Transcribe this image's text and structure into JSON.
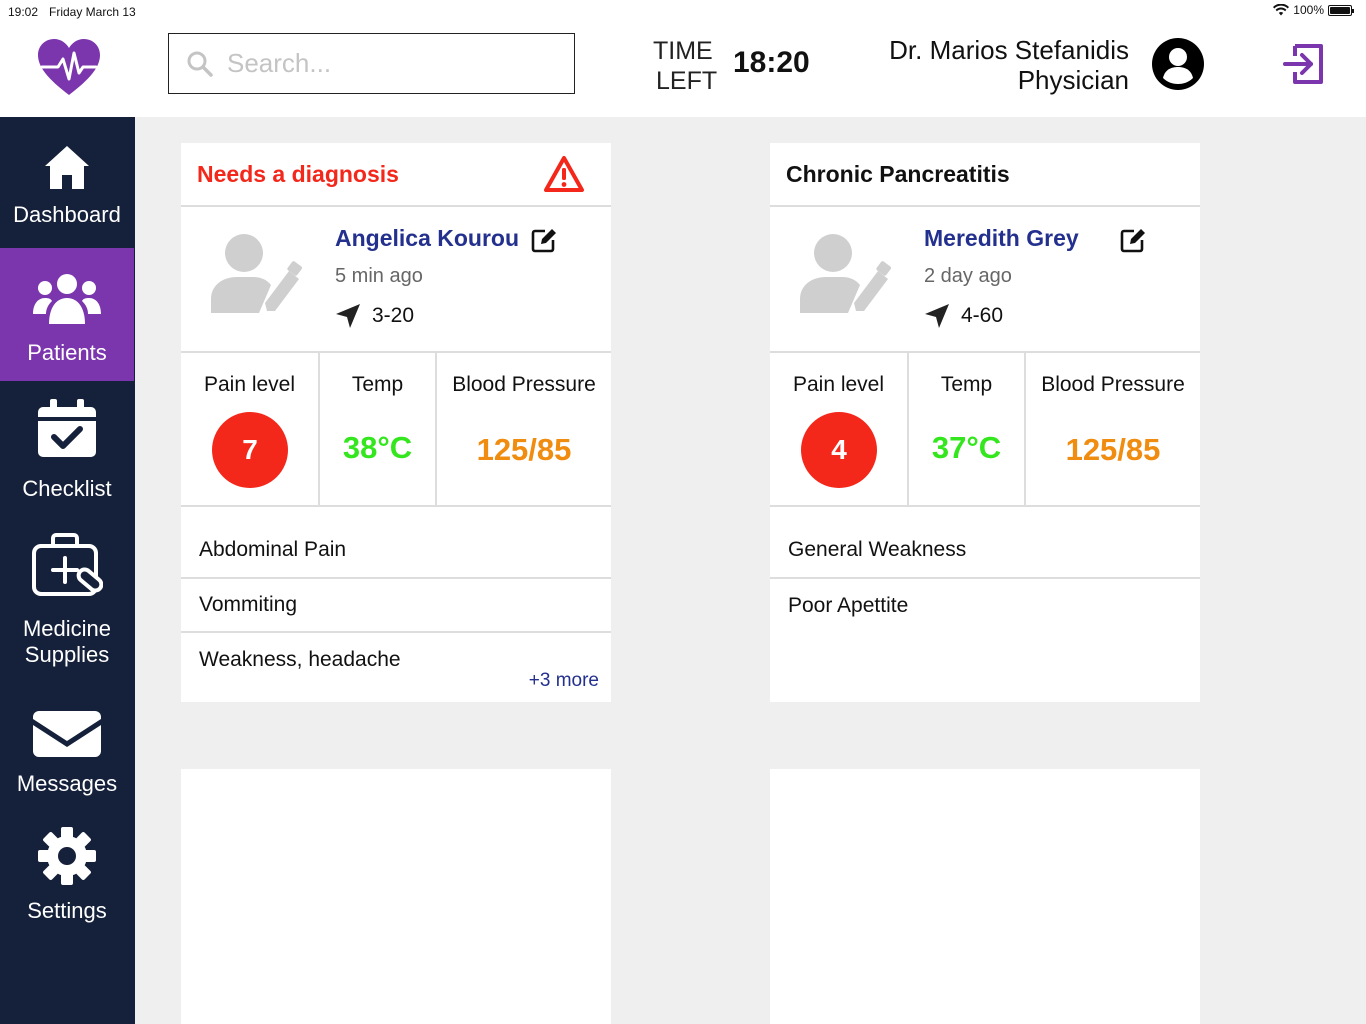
{
  "status_bar": {
    "time": "19:02",
    "date": "Friday March 13",
    "battery": "100%"
  },
  "header": {
    "search_placeholder": "Search...",
    "time_left_line1": "TIME",
    "time_left_line2": "LEFT",
    "timer": "18:20",
    "doctor_name": "Dr. Marios Stefanidis",
    "doctor_role": "Physician"
  },
  "sidebar": {
    "items": [
      {
        "label": "Dashboard",
        "icon": "home-icon"
      },
      {
        "label": "Patients",
        "icon": "users-icon",
        "active": true
      },
      {
        "label": "Checklist",
        "icon": "calendar-check-icon"
      },
      {
        "label_line1": "Medicine",
        "label_line2": "Supplies",
        "icon": "medkit-icon"
      },
      {
        "label": "Messages",
        "icon": "envelope-icon"
      },
      {
        "label": "Settings",
        "icon": "gear-icon"
      }
    ]
  },
  "cards": [
    {
      "title": "Needs a diagnosis",
      "alert": true,
      "patient_name": "Angelica Kourou",
      "time_ago": "5 min ago",
      "room": "3-20",
      "vitals": {
        "pain_label": "Pain level",
        "pain_value": "7",
        "temp_label": "Temp",
        "temp_value": "38°C",
        "bp_label": "Blood Pressure",
        "bp_value": "125/85"
      },
      "symptoms": [
        "Abdominal Pain",
        "Vommiting",
        "Weakness, headache"
      ],
      "more": "+3 more"
    },
    {
      "title": "Chronic Pancreatitis",
      "alert": false,
      "patient_name": "Meredith Grey",
      "time_ago": "2 day ago",
      "room": "4-60",
      "vitals": {
        "pain_label": "Pain level",
        "pain_value": "4",
        "temp_label": "Temp",
        "temp_value": "37°C",
        "bp_label": "Blood Pressure",
        "bp_value": "125/85"
      },
      "symptoms": [
        "General Weakness",
        "Poor Apettite"
      ]
    }
  ],
  "colors": {
    "brand_purple": "#7b35ad",
    "sidebar_bg": "#15213a",
    "alert_red": "#f4271b",
    "name_blue": "#23308e",
    "temp_green": "#33e61d",
    "bp_orange": "#f08c10"
  }
}
